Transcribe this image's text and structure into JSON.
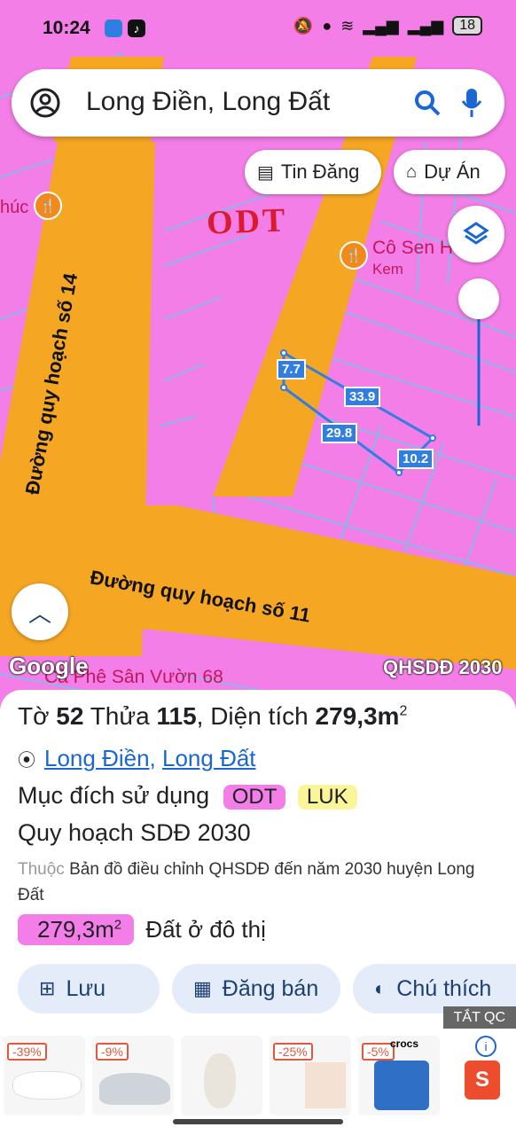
{
  "status_bar": {
    "time": "10:24",
    "battery": "18"
  },
  "search": {
    "query": "Long Điền, Long Đất"
  },
  "chips": {
    "listings": "Tin Đăng",
    "projects": "Dự Án"
  },
  "map": {
    "zone_label": "ODT",
    "road_vertical": "Đường quy hoạch số 14",
    "road_horizontal": "Đường quy hoạch số 11",
    "poi_1": "Cô Sen H",
    "poi_1_sub": "Kem",
    "poi_2": "húc",
    "poi_3": "Cà Phê Sân Vườn 68",
    "google": "Google",
    "layer_badge": "QHSDĐ 2030",
    "dims": {
      "top": "33.9",
      "bottom": "29.8",
      "left": "7.7",
      "right": "10.2"
    }
  },
  "parcel": {
    "prefix_sheet": "Tờ",
    "sheet": "52",
    "prefix_lot": "Thửa",
    "lot": "115",
    "prefix_area": ", Diện tích",
    "area": "279,3m",
    "area_sup": "2",
    "loc_1": "Long Điền",
    "loc_sep": ", ",
    "loc_2": "Long Đất",
    "purpose_label": "Mục đích sử dụng",
    "purpose_1": "ODT",
    "purpose_2": "LUK",
    "plan_title": "Quy hoạch SDĐ 2030",
    "belongs_label": "Thuộc",
    "belongs_text": "Bản đồ điều chỉnh QHSDĐ đến năm 2030 huyện Long Đất",
    "zone_area": "279,3m",
    "zone_area_sup": "2",
    "zone_desc": "Đất ở đô thị"
  },
  "actions": {
    "save": "Lưu",
    "post": "Đăng bán",
    "legend": "Chú thích"
  },
  "ads": {
    "close_label": "TẮT QC",
    "items": [
      {
        "badge": "-39%"
      },
      {
        "badge": "-9%"
      },
      {
        "badge": ""
      },
      {
        "badge": "-25%"
      },
      {
        "badge": "-5%",
        "brand": "crocs"
      }
    ]
  },
  "colors": {
    "odt_pink": "#f47ee8",
    "road_orange": "#f5a623",
    "parcel_blue": "#2f7ee0",
    "link_blue": "#1a66d2",
    "tag_luk": "#fbf59a"
  }
}
